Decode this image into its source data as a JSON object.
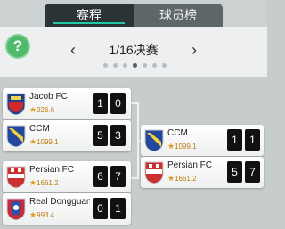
{
  "tabs": [
    {
      "label": "赛程",
      "active": true
    },
    {
      "label": "球员榜",
      "active": false
    }
  ],
  "help_label": "?",
  "round": {
    "title": "1/16决赛",
    "prev_arrow": "‹",
    "next_arrow": "›",
    "page_count": 7,
    "active_page": 3
  },
  "matches_left": [
    {
      "team1": {
        "name": "Jacob FC",
        "rating": "926.6",
        "score": "1",
        "crest": "blue-red-crest"
      },
      "team2": {
        "name": "CCM",
        "rating": "1099.1",
        "score": "5",
        "crest": "blue-yellow-crest"
      },
      "score_col2_team1": "0",
      "score_col2_team2": "3"
    },
    {
      "team1": {
        "name": "Persian FC",
        "rating": "1661.2",
        "score": "6",
        "crest": "red-white-crest"
      },
      "team2": {
        "name": "Real Dongguan.",
        "rating": "993.4",
        "score": "0",
        "crest": "red-blue-crest"
      },
      "score_col2_team1": "7",
      "score_col2_team2": "1"
    }
  ],
  "matches_right": [
    {
      "name": "CCM",
      "rating": "1099.1",
      "score1": "1",
      "score2": "1"
    },
    {
      "name": "Persian FC",
      "rating": "1661.2",
      "score1": "5",
      "score2": "7"
    }
  ],
  "colors": {
    "accent": "#1fc8a6",
    "help": "#4fba6a",
    "rating": "#c07a10"
  }
}
